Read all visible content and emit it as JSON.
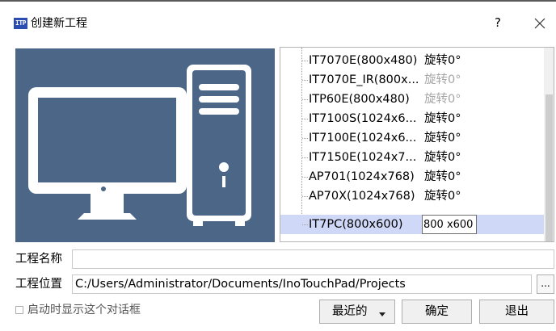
{
  "window": {
    "app_icon_text": "ITP",
    "title": "创建新工程",
    "help_label": "?"
  },
  "resolutions": [
    {
      "name": "IT7070E(800x480)",
      "rotation": "旋转0°",
      "rotation_enabled": true
    },
    {
      "name": "IT7070E_IR(800x...",
      "rotation": "旋转0°",
      "rotation_enabled": false
    },
    {
      "name": "ITP60E(800x480)",
      "rotation": "旋转0°",
      "rotation_enabled": false
    },
    {
      "name": "IT7100S(1024x6...",
      "rotation": "旋转0°",
      "rotation_enabled": true
    },
    {
      "name": "IT7100E(1024x6...",
      "rotation": "旋转0°",
      "rotation_enabled": true
    },
    {
      "name": "IT7150E(1024x7...",
      "rotation": "旋转0°",
      "rotation_enabled": true
    },
    {
      "name": "AP701(1024x768)",
      "rotation": "旋转0°",
      "rotation_enabled": true
    },
    {
      "name": "AP70X(1024x768)",
      "rotation": "旋转0°",
      "rotation_enabled": true
    }
  ],
  "selected_item": {
    "name": "IT7PC(800x600)",
    "resolution_value": "800 x600"
  },
  "form": {
    "name_label": "工程名称",
    "name_value": "",
    "location_label": "工程位置",
    "location_value": "C:/Users/Administrator/Documents/InoTouchPad/Projects",
    "browse_label": "..."
  },
  "footer": {
    "startup_checkbox_label": "启动时显示这个对话框",
    "startup_checked": false,
    "recent_label": "最近的",
    "ok_label": "确定",
    "exit_label": "退出"
  },
  "colors": {
    "preview_bg": "#4b6686",
    "selection_bg": "#cfd8f7",
    "disabled_text": "#a6a6a6",
    "app_icon_bg": "#2b4cb0"
  }
}
